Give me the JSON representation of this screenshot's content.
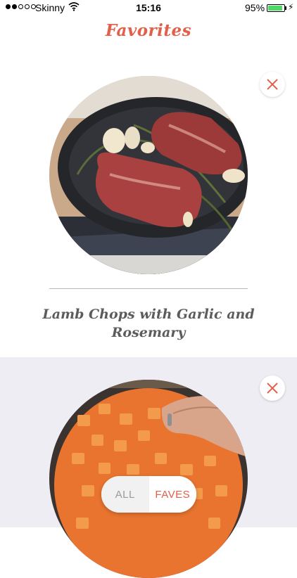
{
  "status_bar": {
    "carrier": "Skinny",
    "time": "15:16",
    "battery_percent": "95%",
    "battery_level": 0.95,
    "icons": [
      "signal-dots-icon",
      "wifi-icon",
      "battery-icon",
      "charging-bolt-icon"
    ]
  },
  "header": {
    "title": "Favorites"
  },
  "favorites": [
    {
      "title": "Lamb Chops with Garlic and Rosemary",
      "image": "lamb chops with garlic and rosemary in a cast iron skillet",
      "remove_icon": "close-icon"
    },
    {
      "title": "",
      "image": "diced butternut squash in a pan",
      "remove_icon": "close-icon"
    }
  ],
  "filter": {
    "options": [
      "ALL",
      "FAVES"
    ],
    "selected": "FAVES"
  },
  "colors": {
    "accent": "#e2604a",
    "second_card_bg": "#eeedf3",
    "title_text": "#5c5c5c"
  }
}
